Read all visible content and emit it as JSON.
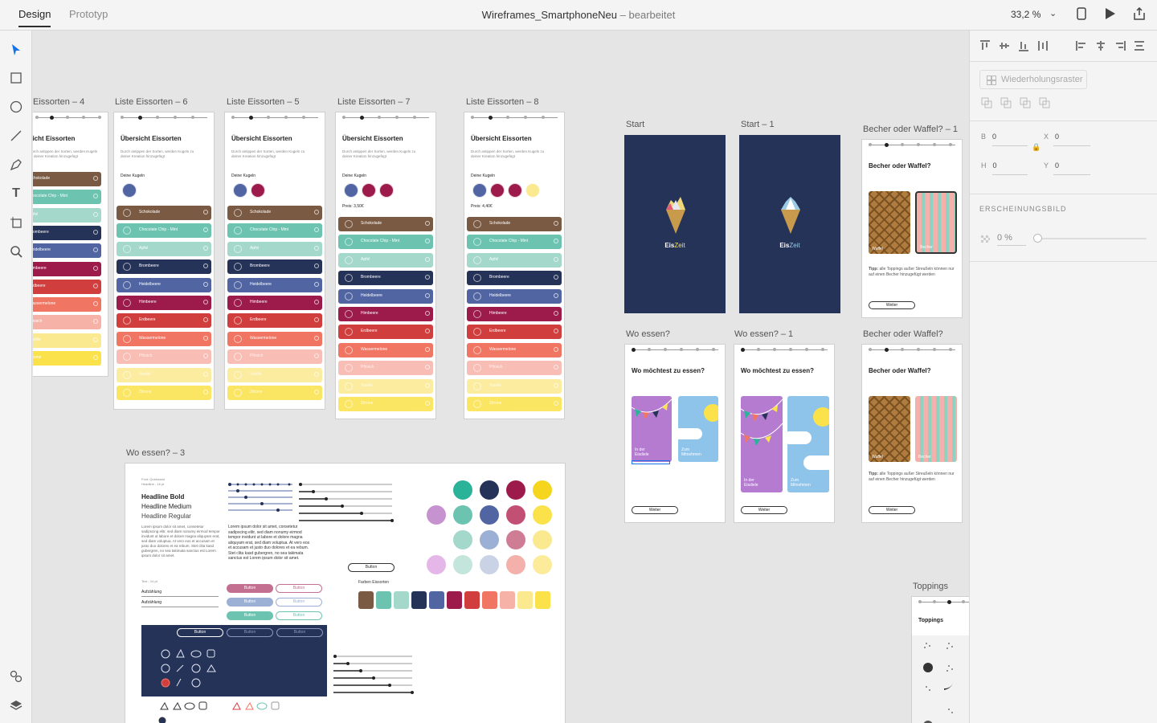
{
  "topbar": {
    "tab_design": "Design",
    "tab_prototype": "Prototyp",
    "doc_name": "Wireframes_SmartphoneNeu",
    "doc_status": "– bearbeitet",
    "zoom": "33,2 %"
  },
  "right_panel": {
    "repeat_grid": "Wiederholungsraster",
    "b_label": "B",
    "b_value": "0",
    "x_label": "X",
    "x_value": "0",
    "h_label": "H",
    "h_value": "0",
    "y_label": "Y",
    "y_value": "0",
    "appearance": "ERSCHEINUNGSBILD",
    "opacity": "0 %"
  },
  "artboards": {
    "l4": "Eissorten – 4",
    "l6": "Liste Eissorten – 6",
    "l5": "Liste Eissorten – 5",
    "l7": "Liste Eissorten – 7",
    "l8": "Liste Eissorten – 8",
    "start": "Start",
    "start1": "Start – 1",
    "becher1": "Becher oder Waffel? – 1",
    "wo": "Wo essen?",
    "wo1": "Wo essen? – 1",
    "becher": "Becher oder Waffel?",
    "wo3": "Wo essen? – 3",
    "toppings": "Toppings"
  },
  "list_screen": {
    "title": "Übersicht Eissorten",
    "title_cut": "sicht Eissorten",
    "subtitle": "Durch antippen der Sorten, werden Kugeln zu deiner Kreation hinzugefügt",
    "kugeln": "Deine Kugeln",
    "price7": "Preis: 3,50€",
    "price8": "Preis: 4,40€",
    "flavors": [
      "Schokolade",
      "Chocolate Chip - Mint",
      "Apfel",
      "Brombeere",
      "Heidelbeere",
      "Himbeere",
      "Erdbeere",
      "Wassermelone",
      "Pfirsich",
      "Vanille",
      "Zitrone"
    ],
    "flavors_cut": [
      "Schokolade",
      "Chocolate Chip - Mint",
      "Apfel",
      "Brombeere",
      "Heidelbeere",
      "Himbeere",
      "Erdbeere",
      "Wassermelone",
      "Pfirsich",
      "Vanille",
      "Zitrone"
    ]
  },
  "start_screen": {
    "brand_a": "Eis",
    "brand_b": "Zeit"
  },
  "becher_screen": {
    "title": "Becher oder Waffel?",
    "waffel": "Waffel",
    "becher": "Becher",
    "tip_bold": "Tipp:",
    "tip": "alle Toppings außer Streußeln können nur auf einen Becher hinzugefügt werden",
    "next": "Weiter"
  },
  "wo_screen": {
    "title": "Wo möchtest zu essen?",
    "opt1": "In der Eisdiele",
    "opt2": "Zum Mitnehmen",
    "next": "Weiter"
  },
  "style_guide": {
    "font_info": "Font: Quicksand",
    "font_size": "Headline - 16 pt",
    "h_bold": "Headline Bold",
    "h_medium": "Headline Medium",
    "h_regular": "Headline Regular",
    "lorem": "Lorem ipsum dolor sit amet, consetetur sadipscing elitr, sed diam nonumy eirmod tempor invidunt ut labore et dolore magna aliquyam erat, sed diam voluptua. At vero eos et accusam et justo duo dolores et ea rebum. Stet clita kasd gubergren, no sea takimata sanctus est Lorem ipsum dolor sit amet.",
    "text_size": "Text - 14 pt",
    "list1": "Aufzählung",
    "list2": "Aufzählung",
    "button": "Button",
    "farben": "Farben Eissorten"
  },
  "toppings_screen": {
    "title": "Toppings"
  },
  "colors": {
    "accent": "#1473e6",
    "navy": "#263358",
    "flavors": [
      "#7a5a43",
      "#6cc4b0",
      "#a3d8cb",
      "#263358",
      "#5165a3",
      "#9c1b4b",
      "#d13e3e",
      "#f07562",
      "#f7b2a8",
      "#fbe98f",
      "#fbe24a"
    ]
  }
}
